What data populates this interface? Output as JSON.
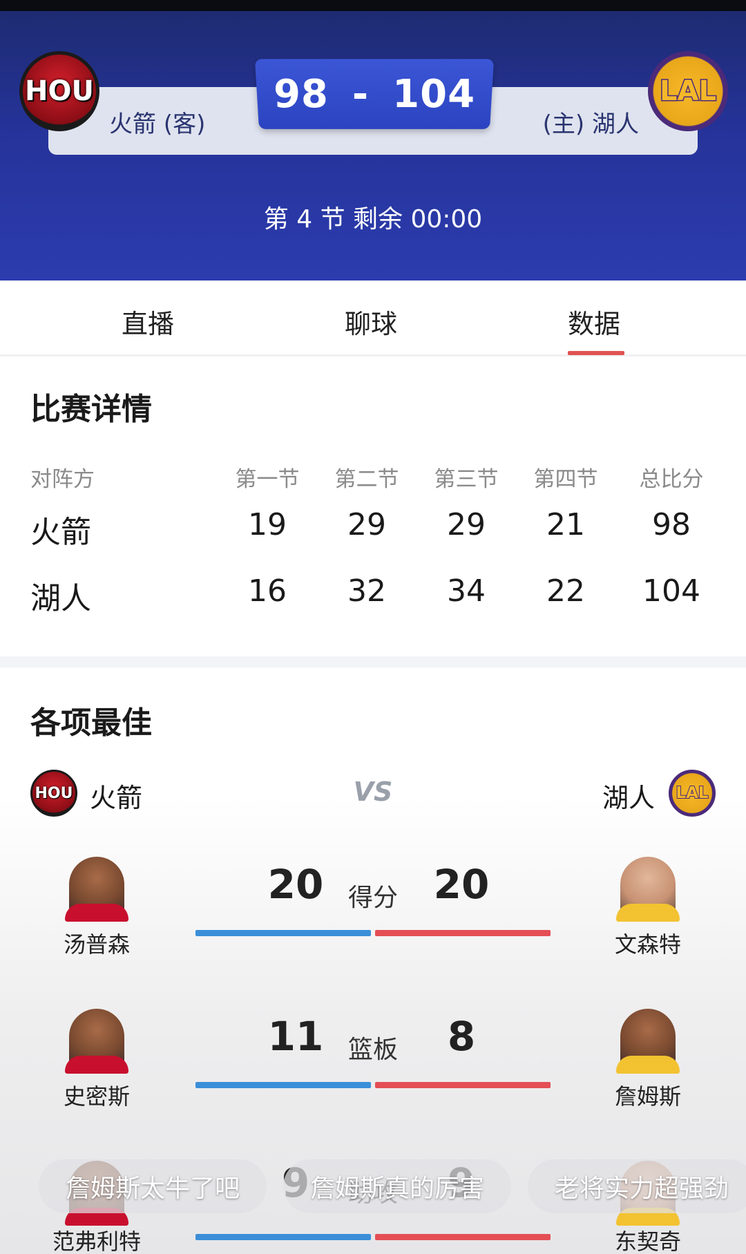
{
  "header": {
    "away_team": "火箭 (客)",
    "home_team": "(主) 湖人",
    "away_score": "98",
    "home_score": "104",
    "dash": "-",
    "away_logo": "HOU",
    "home_logo": "LAL",
    "period": "第 4 节  剩余 00:00"
  },
  "tabs": [
    {
      "label": "直播"
    },
    {
      "label": "聊球"
    },
    {
      "label": "数据",
      "active": true
    }
  ],
  "boxscore": {
    "title": "比赛详情",
    "headers": [
      "对阵方",
      "第一节",
      "第二节",
      "第三节",
      "第四节",
      "总比分"
    ],
    "rows": [
      {
        "team": "火箭",
        "q": [
          "19",
          "29",
          "29",
          "21"
        ],
        "total": "98"
      },
      {
        "team": "湖人",
        "q": [
          "16",
          "32",
          "34",
          "22"
        ],
        "total": "104"
      }
    ]
  },
  "leaders": {
    "title": "各项最佳",
    "away_team": "火箭",
    "home_team": "湖人",
    "vs": "VS",
    "away_logo": "HOU",
    "home_logo": "LAL",
    "stats": [
      {
        "label": "得分",
        "away_value": "20",
        "home_value": "20",
        "away_player": "汤普森",
        "home_player": "文森特"
      },
      {
        "label": "篮板",
        "away_value": "11",
        "home_value": "8",
        "away_player": "史密斯",
        "home_player": "詹姆斯"
      },
      {
        "label": "助攻",
        "away_value": "9",
        "home_value": "9",
        "away_player": "范弗利特",
        "home_player": "东契奇"
      }
    ]
  },
  "danmaku": [
    "詹姆斯太牛了吧",
    "詹姆斯真的厉害",
    "老将实力超强劲"
  ],
  "colors": {
    "header_blue": "#25339a",
    "score_box": "#2b43c0",
    "away_bar": "#3b8fd8",
    "home_bar": "#e44e55",
    "tab_accent": "#e05353"
  }
}
